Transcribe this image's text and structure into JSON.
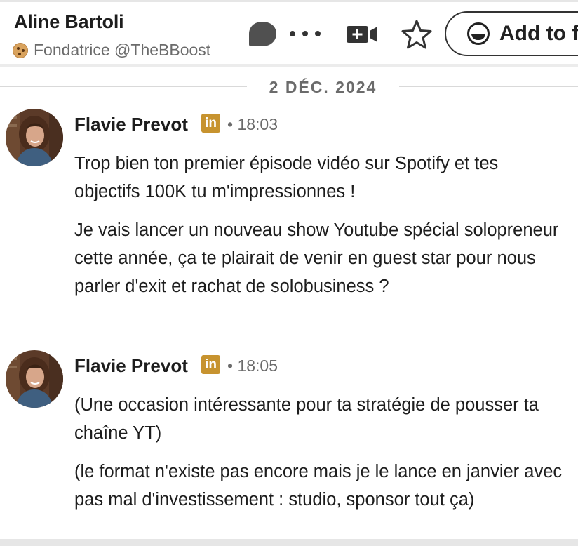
{
  "header": {
    "contact_name": "Aline Bartoli",
    "contact_subtitle": "Fondatrice @TheBBoost",
    "icons": [
      "cookie-emoji",
      "chat-bubble-icon",
      "more-dots-icon",
      "video-call-icon",
      "star-icon",
      "add-to-folder-icon"
    ],
    "add_button_label": "Add to f"
  },
  "date_separator": "2 DÉC. 2024",
  "messages": [
    {
      "sender": "Flavie Prevot",
      "badge": "in",
      "time": "• 18:03",
      "paragraphs": [
        "Trop bien ton premier épisode vidéo sur Spotify et tes objectifs 100K tu m'impressionnes !",
        "Je vais lancer un nouveau show Youtube spécial solopreneur cette année, ça te plairait de venir en guest star pour nous parler d'exit et rachat de solobusiness ?"
      ]
    },
    {
      "sender": "Flavie Prevot",
      "badge": "in",
      "time": "• 18:05",
      "paragraphs": [
        "(Une occasion intéressante pour ta stratégie de pousser ta chaîne YT)",
        "(le format n'existe pas encore mais je le lance en janvier avec pas mal d'investissement : studio, sponsor tout ça)"
      ]
    }
  ],
  "colors": {
    "linkedin_badge": "#c7932f",
    "text_primary": "#1d1d1d",
    "text_secondary": "#6b6b6b"
  }
}
